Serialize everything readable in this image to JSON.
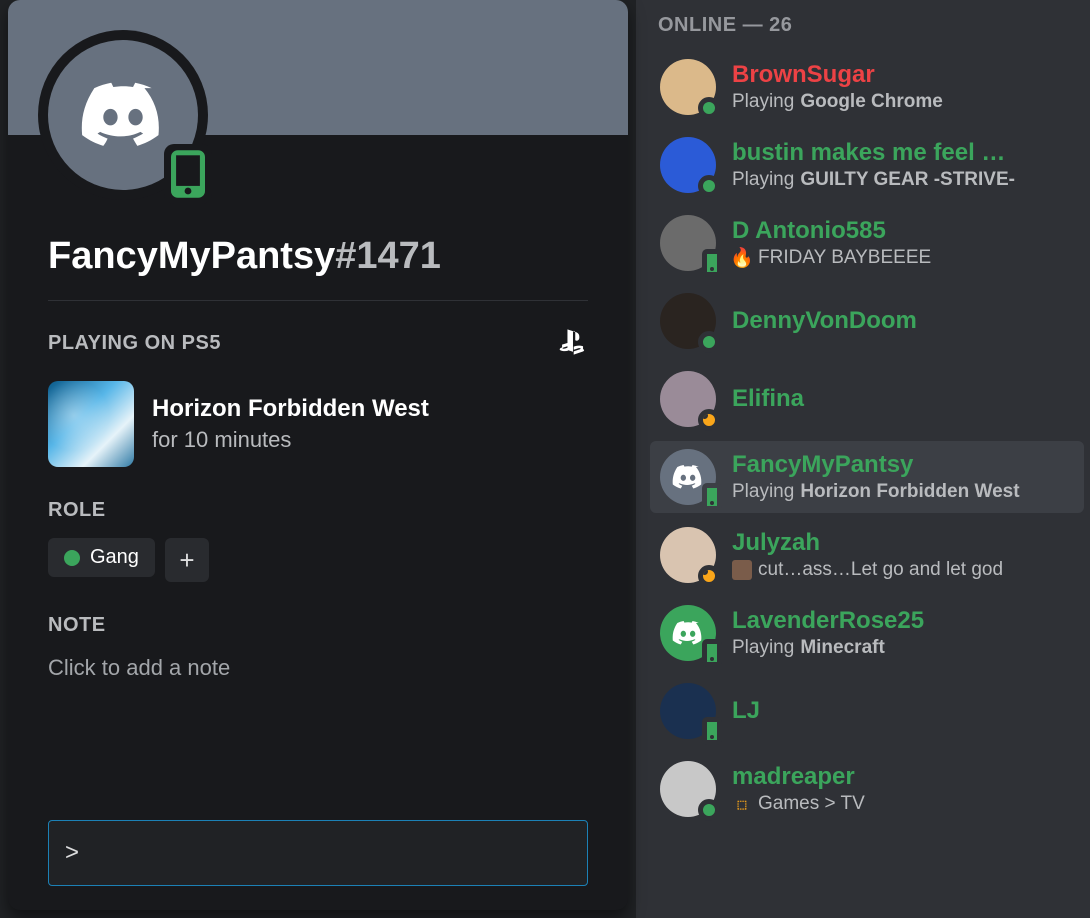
{
  "profile": {
    "username": "FancyMyPantsy",
    "discriminator": "#1471",
    "activity_header": "PLAYING ON PS5",
    "game_title": "Horizon Forbidden West",
    "game_sub": "for 10 minutes",
    "role_header": "ROLE",
    "role_label": "Gang",
    "note_header": "NOTE",
    "note_placeholder": "Click to add a note",
    "input_value": ">"
  },
  "member_list": {
    "group_header": "ONLINE — 26",
    "members": [
      {
        "name": "BrownSugar",
        "color": "#ed4245",
        "status": "online",
        "sub_prefix": "Playing ",
        "sub_bold": "Google Chrome",
        "sub_plain": "",
        "avatar_bg": "#dbb98a",
        "icon": ""
      },
      {
        "name": "bustin makes me feel …",
        "color": "#3ba55c",
        "status": "online",
        "sub_prefix": "Playing ",
        "sub_bold": "GUILTY GEAR -STRIVE-",
        "sub_plain": "",
        "avatar_bg": "#2b5bd7",
        "icon": ""
      },
      {
        "name": "D Antonio585",
        "color": "#3ba55c",
        "status": "mobile",
        "sub_prefix": "",
        "sub_bold": "",
        "sub_plain": "FRIDAY BAYBEEEE",
        "avatar_bg": "#6b6b6b",
        "icon": "fire"
      },
      {
        "name": "DennyVonDoom",
        "color": "#3ba55c",
        "status": "online",
        "sub_prefix": "",
        "sub_bold": "",
        "sub_plain": "",
        "avatar_bg": "#2a2420",
        "icon": ""
      },
      {
        "name": "Elifina",
        "color": "#3ba55c",
        "status": "idle",
        "sub_prefix": "",
        "sub_bold": "",
        "sub_plain": "",
        "avatar_bg": "#9a8b98",
        "icon": ""
      },
      {
        "name": "FancyMyPantsy",
        "color": "#3ba55c",
        "status": "mobile",
        "sub_prefix": "Playing ",
        "sub_bold": "Horizon Forbidden West",
        "sub_plain": "",
        "avatar_bg": "#67717f",
        "icon": "",
        "selected": true,
        "discord_avatar": true
      },
      {
        "name": "Julyzah",
        "color": "#3ba55c",
        "status": "idle",
        "sub_prefix": "",
        "sub_bold": "",
        "sub_plain": "cut…ass…Let go and let god",
        "avatar_bg": "#d9c4b0",
        "icon": "img"
      },
      {
        "name": "LavenderRose25",
        "color": "#3ba55c",
        "status": "mobile",
        "sub_prefix": "Playing ",
        "sub_bold": "Minecraft",
        "sub_plain": "",
        "avatar_bg": "#3ba55c",
        "icon": "",
        "discord_avatar": true
      },
      {
        "name": "LJ",
        "color": "#3ba55c",
        "status": "mobile",
        "sub_prefix": "",
        "sub_bold": "",
        "sub_plain": "",
        "avatar_bg": "#1a3050",
        "icon": ""
      },
      {
        "name": "madreaper",
        "color": "#3ba55c",
        "status": "online",
        "sub_prefix": "",
        "sub_bold": "",
        "sub_plain": "Games > TV",
        "avatar_bg": "#c8c8c8",
        "icon": "wasd"
      }
    ]
  }
}
